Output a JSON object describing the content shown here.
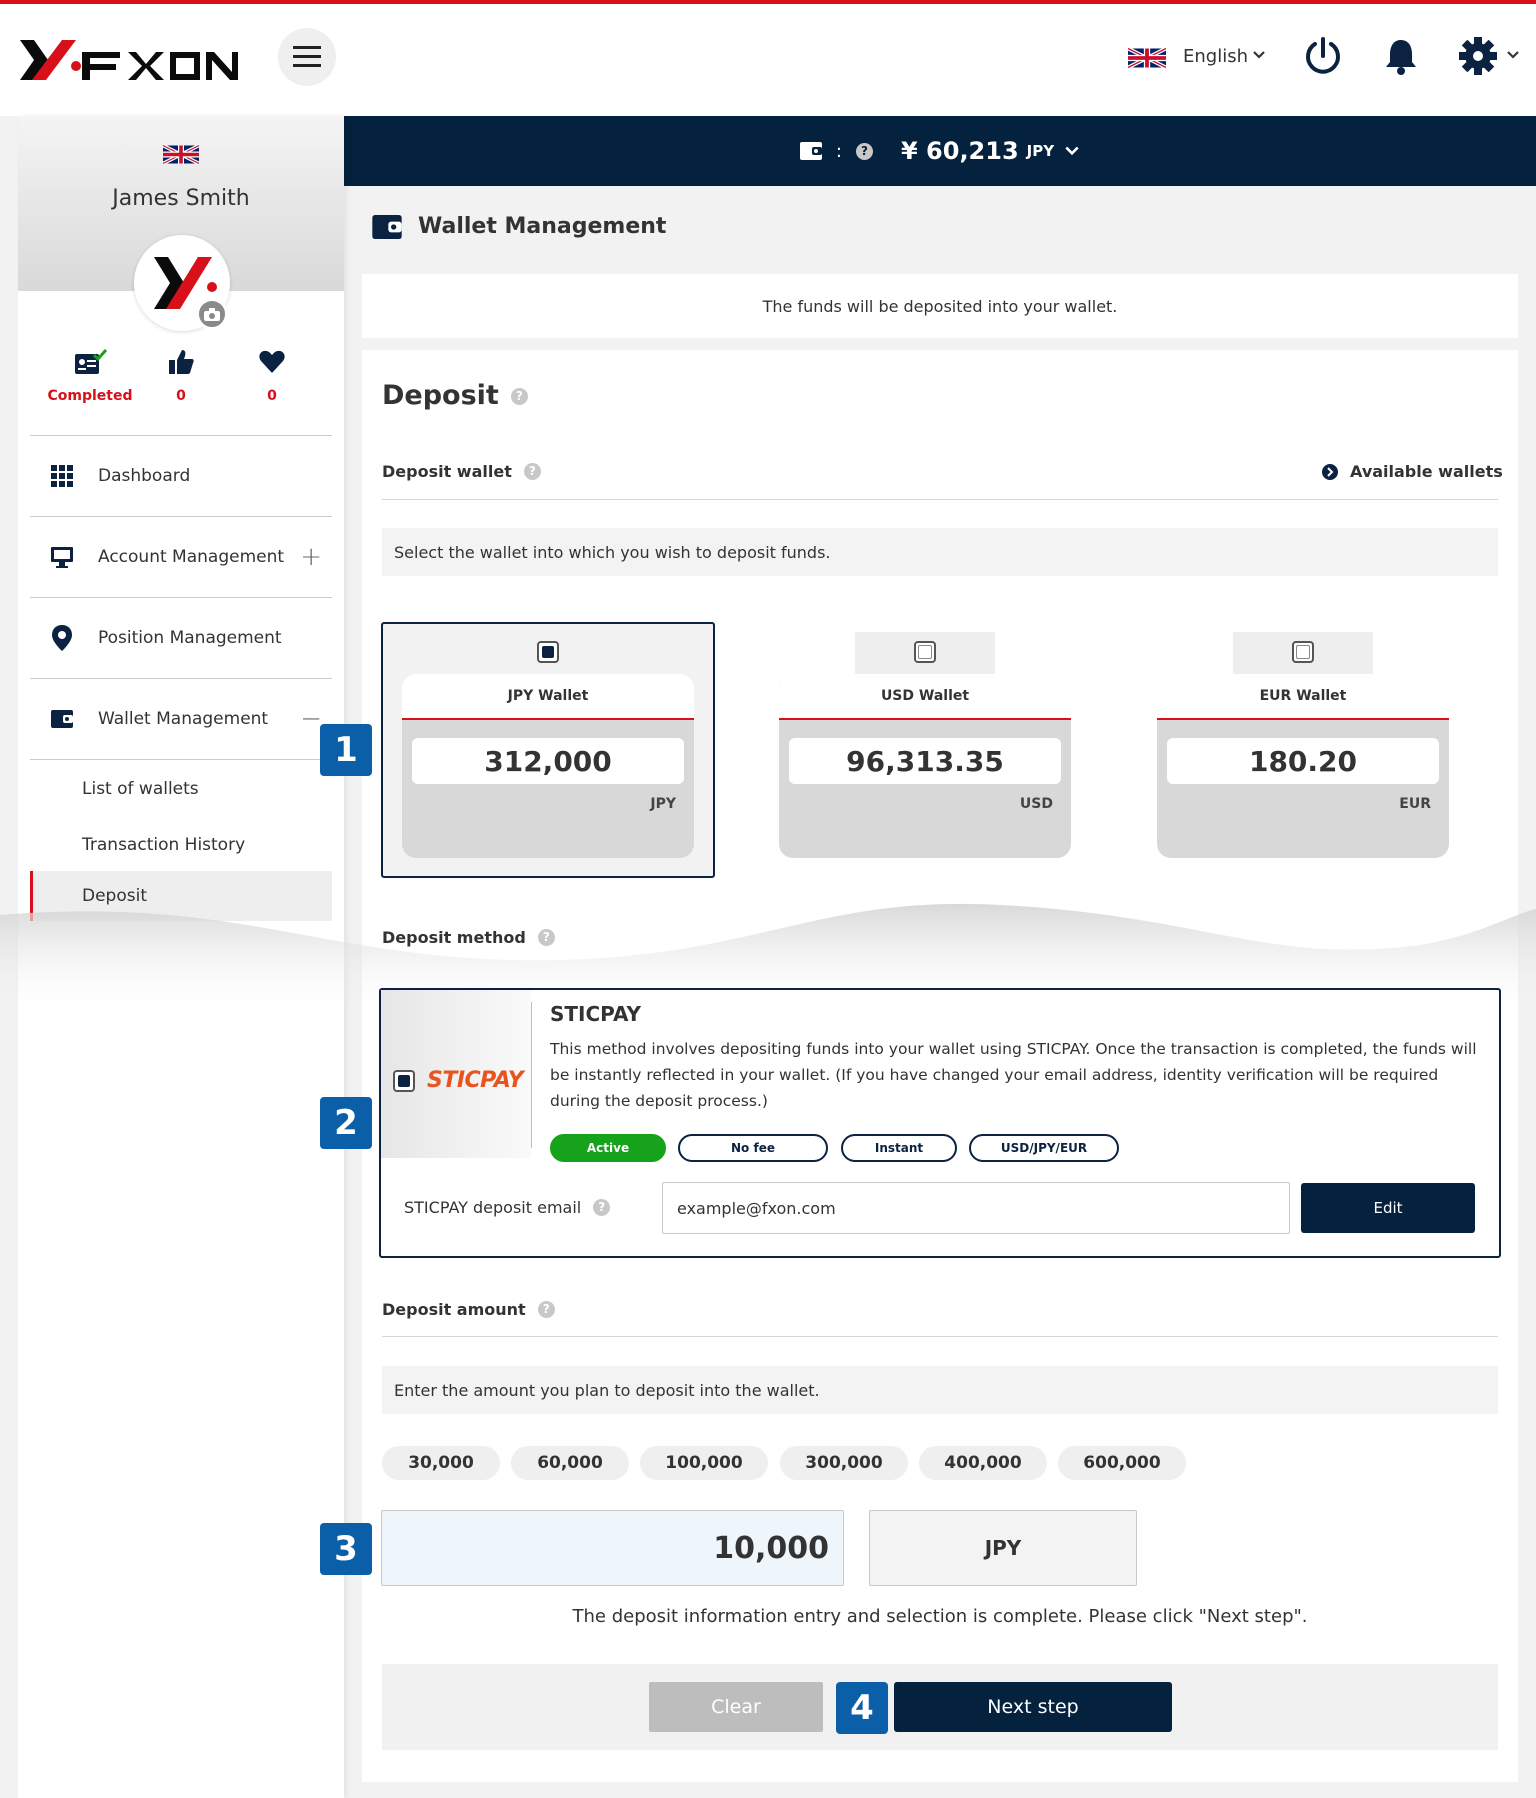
{
  "header": {
    "language": "English"
  },
  "balance": {
    "amount": "¥ 60,213",
    "currency": "JPY"
  },
  "sidebar": {
    "user_name": "James Smith",
    "stats": [
      {
        "label": "Completed"
      },
      {
        "label": "0"
      },
      {
        "label": "0"
      }
    ],
    "items": [
      {
        "label": "Dashboard"
      },
      {
        "label": "Account Management",
        "toggle": "+"
      },
      {
        "label": "Position Management"
      },
      {
        "label": "Wallet Management",
        "toggle": "−"
      }
    ],
    "subitems": [
      {
        "label": "List of wallets"
      },
      {
        "label": "Transaction History"
      },
      {
        "label": "Deposit"
      }
    ]
  },
  "page": {
    "title": "Wallet Management",
    "notice": "The funds will be deposited into your wallet."
  },
  "deposit": {
    "title": "Deposit",
    "wallet_section": "Deposit wallet",
    "available_wallets": "Available wallets",
    "wallet_hint": "Select the wallet into which you wish to deposit funds.",
    "wallets": [
      {
        "name": "JPY Wallet",
        "value": "312,000",
        "currency": "JPY"
      },
      {
        "name": "USD Wallet",
        "value": "96,313.35",
        "currency": "USD"
      },
      {
        "name": "EUR Wallet",
        "value": "180.20",
        "currency": "EUR"
      }
    ],
    "method_section": "Deposit method",
    "method": {
      "logo_text": "STICPAY",
      "title": "STICPAY",
      "description": "This method involves depositing funds into your wallet using STICPAY. Once the transaction is completed, the funds will be instantly reflected in your wallet. (If you have changed your email address, identity verification will be required during the deposit process.)",
      "tags": [
        "Active",
        "No fee",
        "Instant",
        "USD/JPY/EUR"
      ],
      "email_label": "STICPAY deposit email",
      "email_value": "example@fxon.com",
      "edit_label": "Edit"
    },
    "amount_section": "Deposit amount",
    "amount_hint": "Enter the amount you plan to deposit into the wallet.",
    "presets": [
      "30,000",
      "60,000",
      "100,000",
      "300,000",
      "400,000",
      "600,000"
    ],
    "amount_value": "10,000",
    "amount_currency": "JPY",
    "complete_message": "The deposit information entry and selection is complete. Please click \"Next step\".",
    "clear_label": "Clear",
    "next_label": "Next step"
  },
  "markers": [
    "1",
    "2",
    "3",
    "4"
  ],
  "colors": {
    "brand_red": "#d7101a",
    "navy": "#04213d",
    "marker_blue": "#0a5fa8",
    "active_green": "#16a21a",
    "sticpay_orange": "#e8531e"
  }
}
